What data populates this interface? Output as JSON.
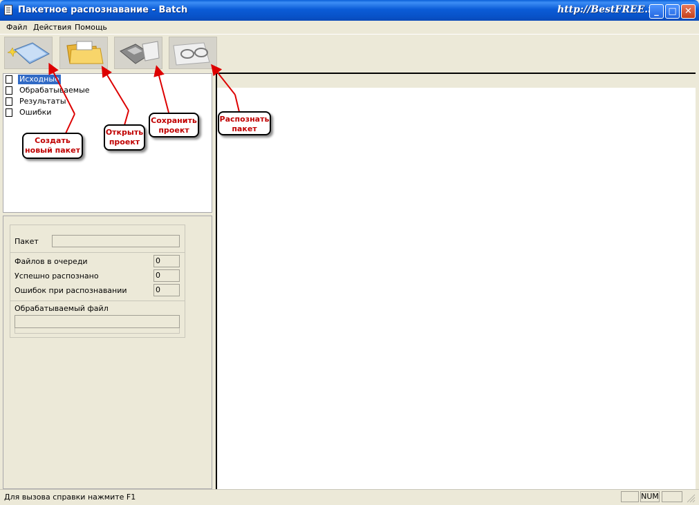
{
  "window": {
    "title": "Пакетное распознавание - Batch",
    "watermark": "http://BestFREE.ru",
    "controls": {
      "minimize": "_",
      "maximize": "□",
      "close": "✕"
    }
  },
  "menu": {
    "items": [
      {
        "label": "Файл"
      },
      {
        "label": "Действия"
      },
      {
        "label": "Помощь"
      }
    ]
  },
  "toolbar": {
    "buttons": [
      {
        "icon": "new-batch-icon"
      },
      {
        "icon": "open-folder-icon"
      },
      {
        "icon": "save-disk-icon"
      },
      {
        "icon": "recognize-glasses-icon"
      }
    ]
  },
  "tree": {
    "items": [
      {
        "label": "Исходные",
        "selected": true
      },
      {
        "label": "Обрабатываемые"
      },
      {
        "label": "Результаты"
      },
      {
        "label": "Ошибки"
      }
    ]
  },
  "info": {
    "packet_label": "Пакет",
    "packet_value": "",
    "files_in_queue_label": "Файлов в очереди",
    "files_in_queue_value": "0",
    "success_label": "Успешно распознано",
    "success_value": "0",
    "errors_label": "Ошибок при распознавании",
    "errors_value": "0",
    "current_file_label": "Обрабатываемый файл",
    "current_file_value": ""
  },
  "statusbar": {
    "text": "Для вызова справки нажмите F1",
    "num": "NUM"
  },
  "annotations": {
    "create": "Создать новый пакет",
    "open": "Открыть проект",
    "save": "Сохранить проект",
    "recognize": "Распознать пакет",
    "color": "#CC0000"
  }
}
